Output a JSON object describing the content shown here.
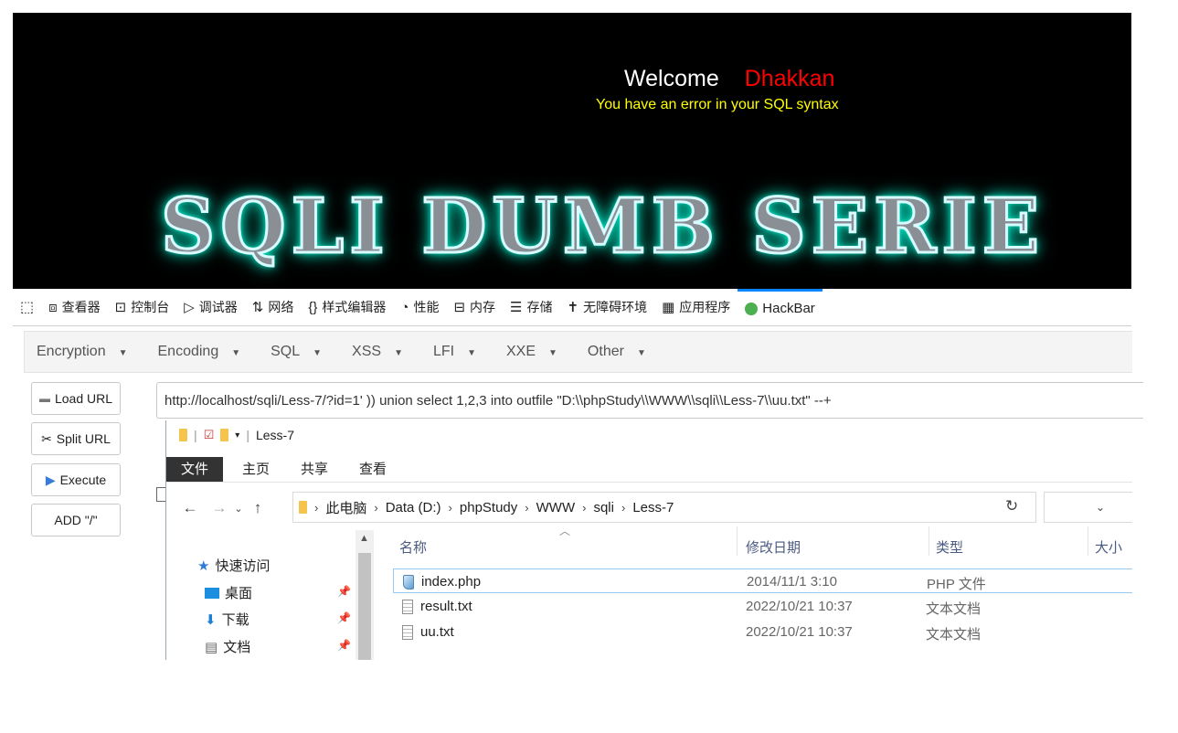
{
  "webpage": {
    "welcome_text": "Welcome",
    "username": "Dhakkan",
    "error_text": "You have an error in your SQL syntax",
    "banner": "SQLI DUMB SERIE"
  },
  "devtools": {
    "tabs": [
      {
        "label": "查看器",
        "icon": "inspector-icon"
      },
      {
        "label": "控制台",
        "icon": "console-icon"
      },
      {
        "label": "调试器",
        "icon": "debugger-icon"
      },
      {
        "label": "网络",
        "icon": "network-icon"
      },
      {
        "label": "样式编辑器",
        "icon": "style-editor-icon"
      },
      {
        "label": "性能",
        "icon": "performance-icon"
      },
      {
        "label": "内存",
        "icon": "memory-icon"
      },
      {
        "label": "存储",
        "icon": "storage-icon"
      },
      {
        "label": "无障碍环境",
        "icon": "accessibility-icon"
      },
      {
        "label": "应用程序",
        "icon": "application-icon"
      },
      {
        "label": "HackBar",
        "icon": "hackbar-icon"
      }
    ],
    "active_tab": "HackBar",
    "accent": "#0a84ff"
  },
  "hackbar": {
    "menu": [
      "Encryption",
      "Encoding",
      "SQL",
      "XSS",
      "LFI",
      "XXE",
      "Other"
    ],
    "buttons": {
      "load_url": "Load URL",
      "split_url": "Split URL",
      "execute": "Execute",
      "add_slash": "ADD \"/\""
    },
    "url_value": "http://localhost/sqli/Less-7/?id=1' )) union select 1,2,3 into outfile \"D:\\\\phpStudy\\\\WWW\\\\sqli\\\\Less-7\\\\uu.txt\" --+"
  },
  "explorer": {
    "title": "Less-7",
    "ribbon_tabs": [
      "文件",
      "主页",
      "共享",
      "查看"
    ],
    "breadcrumb": [
      "此电脑",
      "Data (D:)",
      "phpStudy",
      "WWW",
      "sqli",
      "Less-7"
    ],
    "nav_items": [
      {
        "label": "快速访问",
        "icon": "star-icon"
      },
      {
        "label": "桌面",
        "icon": "desktop-icon"
      },
      {
        "label": "下载",
        "icon": "download-icon"
      },
      {
        "label": "文档",
        "icon": "document-icon"
      }
    ],
    "columns": [
      "名称",
      "修改日期",
      "类型",
      "大小"
    ],
    "files": [
      {
        "name": "index.php",
        "date": "2014/11/1 3:10",
        "type": "PHP 文件",
        "icon": "php-file-icon"
      },
      {
        "name": "result.txt",
        "date": "2022/10/21 10:37",
        "type": "文本文档",
        "icon": "text-file-icon"
      },
      {
        "name": "uu.txt",
        "date": "2022/10/21 10:37",
        "type": "文本文档",
        "icon": "text-file-icon"
      }
    ]
  }
}
